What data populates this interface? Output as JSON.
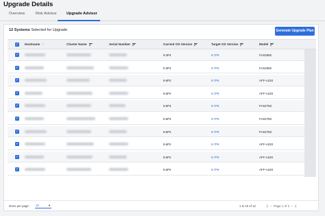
{
  "page": {
    "title": "Upgrade Details"
  },
  "tabs": [
    {
      "label": "Overview"
    },
    {
      "label": "Risk Advisor"
    },
    {
      "label": "Upgrade Advisor"
    }
  ],
  "card": {
    "selected_count": "12 Systems",
    "selected_suffix": " Selected for Upgrade",
    "generate_button": "Generate Upgrade Plan"
  },
  "table": {
    "columns": {
      "hostname": "Hostname",
      "cluster": "Cluster Name",
      "serial": "Serial Number",
      "current_os": "Current OS Version",
      "target_os": "Target OS Version",
      "model": "Model"
    },
    "rows": [
      {
        "current_os": "9.3P4",
        "target_os": "9.7P8",
        "model": "FAS2650"
      },
      {
        "current_os": "9.3P4",
        "target_os": "9.7P8",
        "model": "FAS2650"
      },
      {
        "current_os": "9.6P2",
        "target_os": "9.7P8",
        "model": "AFF-A220"
      },
      {
        "current_os": "9.6P2",
        "target_os": "9.7P8",
        "model": "AFF-A220"
      },
      {
        "current_os": "9.5P3",
        "target_os": "9.7P8",
        "model": "FAS2750"
      },
      {
        "current_os": "9.5P3",
        "target_os": "9.7P8",
        "model": "FAS2750"
      },
      {
        "current_os": "9.6P2",
        "target_os": "9.7P8",
        "model": "FAS2750"
      },
      {
        "current_os": "9.6P2",
        "target_os": "9.7P8",
        "model": "AFF-A220"
      },
      {
        "current_os": "9.6P2",
        "target_os": "9.7P8",
        "model": "AFF-A220"
      },
      {
        "current_os": "9.6P2",
        "target_os": "9.7P8",
        "model": "AFF-A220"
      }
    ]
  },
  "footer": {
    "items_per_page_label": "Items per page:",
    "items_per_page_value": "10",
    "range_text": "1 to 10 of 12",
    "page_text": "Page 1 of 2"
  },
  "colors": {
    "accent": "#2f6fdb"
  },
  "icons": {
    "sort": "arrow-up-icon",
    "filter": "filter-lines-icon",
    "checkbox": "checkbox-checked-icon"
  }
}
